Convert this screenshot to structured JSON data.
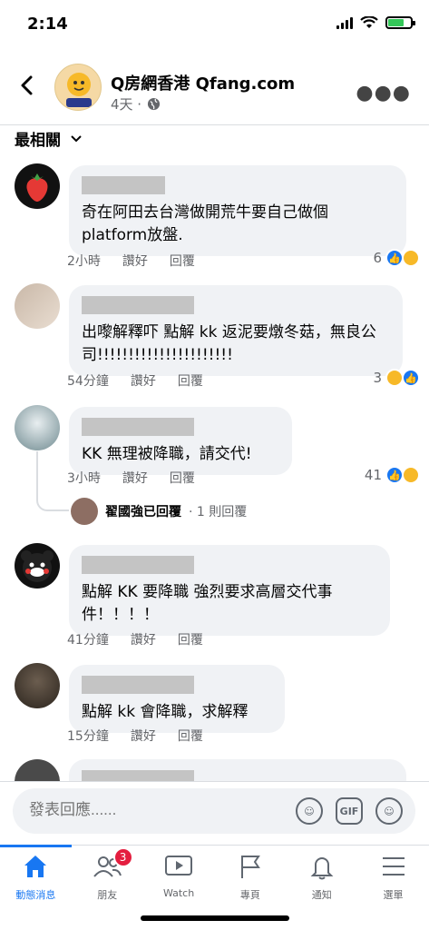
{
  "status": {
    "time": "2:14"
  },
  "header": {
    "page_name": "Q房網香港 Qfang.com",
    "time_ago": "4天 ·"
  },
  "sort": {
    "label": "最相關"
  },
  "comments": [
    {
      "text": "奇在阿田去台灣做開荒牛要自己做個platform放盤.",
      "time": "2小時",
      "like": "讚好",
      "reply": "回覆",
      "reactions": "6"
    },
    {
      "text": "出嚟解釋吓 點解 kk 返泥要燉冬菇，無良公司!!!!!!!!!!!!!!!!!!!!!!",
      "time": "54分鐘",
      "like": "讚好",
      "reply": "回覆",
      "reactions": "3"
    },
    {
      "text": "KK 無理被降職，請交代!",
      "time": "3小時",
      "like": "讚好",
      "reply": "回覆",
      "reactions": "41"
    },
    {
      "text": "點解 KK 要降職 強烈要求高層交代事件！！！！",
      "time": "41分鐘",
      "like": "讚好",
      "reply": "回覆",
      "reactions": ""
    },
    {
      "text": "點解 kk 會降職，求解釋",
      "time": "15分鐘",
      "like": "讚好",
      "reply": "回覆",
      "reactions": ""
    }
  ],
  "reply_summary": {
    "name": "翟國強已回覆",
    "count": "· 1 則回覆"
  },
  "composer": {
    "placeholder": "發表回應......"
  },
  "tabs": [
    {
      "label": "動態消息"
    },
    {
      "label": "朋友",
      "badge": "3"
    },
    {
      "label": "Watch"
    },
    {
      "label": "專頁"
    },
    {
      "label": "通知"
    },
    {
      "label": "選單"
    }
  ],
  "colors": {
    "accent": "#1877f2",
    "badge": "#e41e3f",
    "bubble": "#f0f2f5"
  }
}
